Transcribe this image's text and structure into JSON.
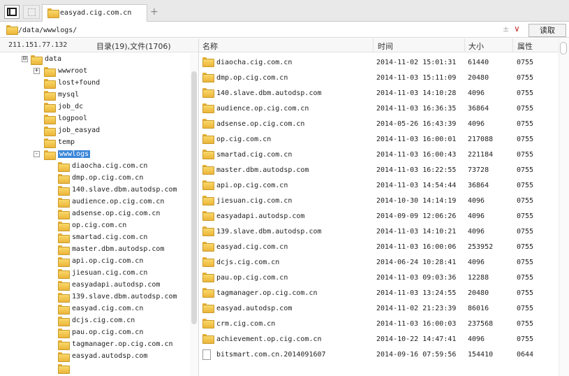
{
  "tab": {
    "label": "easyad.cig.com.cn",
    "add_symbol": "+"
  },
  "address": {
    "path": "/data/wwwlogs/",
    "aux_symbol": "±",
    "dropdown_symbol": "∨",
    "read_label": "读取"
  },
  "info": {
    "ip": "211.151.77.132",
    "counts": "目录(19),文件(1706)"
  },
  "tree": {
    "root": {
      "label": "data",
      "toggle": "⊟"
    },
    "children": [
      {
        "label": "wwwroot",
        "toggle": "+"
      },
      {
        "label": "lost+found"
      },
      {
        "label": "mysql"
      },
      {
        "label": "job_dc"
      },
      {
        "label": "logpool"
      },
      {
        "label": "job_easyad"
      },
      {
        "label": "temp"
      },
      {
        "label": "wwwlogs",
        "toggle": "-",
        "selected": true
      }
    ],
    "wwwlogs_children": [
      "diaocha.cig.com.cn",
      "dmp.op.cig.com.cn",
      "140.slave.dbm.autodsp.com",
      "audience.op.cig.com.cn",
      "adsense.op.cig.com.cn",
      "op.cig.com.cn",
      "smartad.cig.com.cn",
      "master.dbm.autodsp.com",
      "api.op.cig.com.cn",
      "jiesuan.cig.com.cn",
      "easyadapi.autodsp.com",
      "139.slave.dbm.autodsp.com",
      "easyad.cig.com.cn",
      "dcjs.cig.com.cn",
      "pau.op.cig.com.cn",
      "tagmanager.op.cig.com.cn",
      "easyad.autodsp.com"
    ]
  },
  "columns": {
    "name": "名称",
    "time": "时间",
    "size": "大小",
    "attr": "属性"
  },
  "files": [
    {
      "name": "diaocha.cig.com.cn",
      "time": "2014-11-02 15:01:31",
      "size": "61440",
      "attr": "0755",
      "type": "folder"
    },
    {
      "name": "dmp.op.cig.com.cn",
      "time": "2014-11-03 15:11:09",
      "size": "20480",
      "attr": "0755",
      "type": "folder"
    },
    {
      "name": "140.slave.dbm.autodsp.com",
      "time": "2014-11-03 14:10:28",
      "size": "4096",
      "attr": "0755",
      "type": "folder"
    },
    {
      "name": "audience.op.cig.com.cn",
      "time": "2014-11-03 16:36:35",
      "size": "36864",
      "attr": "0755",
      "type": "folder"
    },
    {
      "name": "adsense.op.cig.com.cn",
      "time": "2014-05-26 16:43:39",
      "size": "4096",
      "attr": "0755",
      "type": "folder"
    },
    {
      "name": "op.cig.com.cn",
      "time": "2014-11-03 16:00:01",
      "size": "217088",
      "attr": "0755",
      "type": "folder"
    },
    {
      "name": "smartad.cig.com.cn",
      "time": "2014-11-03 16:00:43",
      "size": "221184",
      "attr": "0755",
      "type": "folder"
    },
    {
      "name": "master.dbm.autodsp.com",
      "time": "2014-11-03 16:22:55",
      "size": "73728",
      "attr": "0755",
      "type": "folder"
    },
    {
      "name": "api.op.cig.com.cn",
      "time": "2014-11-03 14:54:44",
      "size": "36864",
      "attr": "0755",
      "type": "folder"
    },
    {
      "name": "jiesuan.cig.com.cn",
      "time": "2014-10-30 14:14:19",
      "size": "4096",
      "attr": "0755",
      "type": "folder"
    },
    {
      "name": "easyadapi.autodsp.com",
      "time": "2014-09-09 12:06:26",
      "size": "4096",
      "attr": "0755",
      "type": "folder"
    },
    {
      "name": "139.slave.dbm.autodsp.com",
      "time": "2014-11-03 14:10:21",
      "size": "4096",
      "attr": "0755",
      "type": "folder"
    },
    {
      "name": "easyad.cig.com.cn",
      "time": "2014-11-03 16:00:06",
      "size": "253952",
      "attr": "0755",
      "type": "folder"
    },
    {
      "name": "dcjs.cig.com.cn",
      "time": "2014-06-24 10:28:41",
      "size": "4096",
      "attr": "0755",
      "type": "folder"
    },
    {
      "name": "pau.op.cig.com.cn",
      "time": "2014-11-03 09:03:36",
      "size": "12288",
      "attr": "0755",
      "type": "folder"
    },
    {
      "name": "tagmanager.op.cig.com.cn",
      "time": "2014-11-03 13:24:55",
      "size": "20480",
      "attr": "0755",
      "type": "folder"
    },
    {
      "name": "easyad.autodsp.com",
      "time": "2014-11-02 21:23:39",
      "size": "86016",
      "attr": "0755",
      "type": "folder"
    },
    {
      "name": "crm.cig.com.cn",
      "time": "2014-11-03 16:00:03",
      "size": "237568",
      "attr": "0755",
      "type": "folder"
    },
    {
      "name": "achievement.op.cig.com.cn",
      "time": "2014-10-22 14:47:41",
      "size": "4096",
      "attr": "0755",
      "type": "folder"
    },
    {
      "name": "bitsmart.com.cn.2014091607",
      "time": "2014-09-16 07:59:56",
      "size": "154410",
      "attr": "0644",
      "type": "file"
    }
  ],
  "colors": {
    "selection": "#3a86d8",
    "folder": "#f2c450",
    "dropdown_arrow": "#c03030"
  }
}
